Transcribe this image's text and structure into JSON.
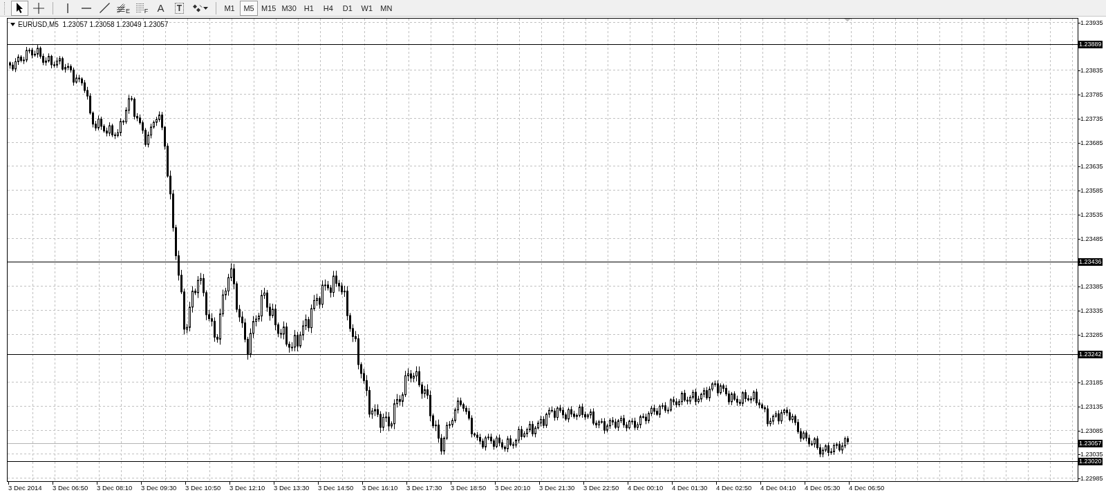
{
  "toolbar": {
    "tools": [
      {
        "kind": "cursor",
        "selected": true
      },
      {
        "kind": "crosshair",
        "selected": false
      },
      {
        "kind": "vline",
        "selected": false
      },
      {
        "kind": "hline",
        "selected": false
      },
      {
        "kind": "trendline",
        "selected": false
      },
      {
        "kind": "fibo",
        "glyph": "E",
        "selected": false
      },
      {
        "kind": "grid",
        "glyph": "F",
        "selected": false
      },
      {
        "kind": "text",
        "glyph": "A",
        "selected": false
      },
      {
        "kind": "label",
        "glyph": "T",
        "selected": false
      },
      {
        "kind": "arrows",
        "selected": false
      }
    ],
    "timeframes": [
      {
        "label": "M1",
        "selected": false
      },
      {
        "label": "M5",
        "selected": true
      },
      {
        "label": "M15",
        "selected": false
      },
      {
        "label": "M30",
        "selected": false
      },
      {
        "label": "H1",
        "selected": false
      },
      {
        "label": "H4",
        "selected": false
      },
      {
        "label": "D1",
        "selected": false
      },
      {
        "label": "W1",
        "selected": false
      },
      {
        "label": "MN",
        "selected": false
      }
    ]
  },
  "chart": {
    "header": "EURUSD,M5  1.23057 1.23058 1.23049 1.23057",
    "price_labels": [
      "1.23935",
      "1.23835",
      "1.23785",
      "1.23735",
      "1.23685",
      "1.23635",
      "1.23585",
      "1.23535",
      "1.23485",
      "1.23385",
      "1.23335",
      "1.23285",
      "1.23185",
      "1.23135",
      "1.23085",
      "1.23035",
      "1.22985"
    ],
    "level_labels": [
      {
        "label": "1.23889",
        "kind": "level"
      },
      {
        "label": "1.23436",
        "kind": "level"
      },
      {
        "label": "1.23242",
        "kind": "level"
      },
      {
        "label": "1.23057",
        "kind": "bid"
      },
      {
        "label": "1.23020",
        "kind": "level"
      }
    ],
    "time_labels": [
      "3 Dec 2014",
      "3 Dec 06:50",
      "3 Dec 08:10",
      "3 Dec 09:30",
      "3 Dec 10:50",
      "3 Dec 12:10",
      "3 Dec 13:30",
      "3 Dec 14:50",
      "3 Dec 16:10",
      "3 Dec 17:30",
      "3 Dec 18:50",
      "3 Dec 20:10",
      "3 Dec 21:30",
      "3 Dec 22:50",
      "4 Dec 00:10",
      "4 Dec 01:30",
      "4 Dec 02:50",
      "4 Dec 04:10",
      "4 Dec 05:30",
      "4 Dec 06:50"
    ]
  }
}
